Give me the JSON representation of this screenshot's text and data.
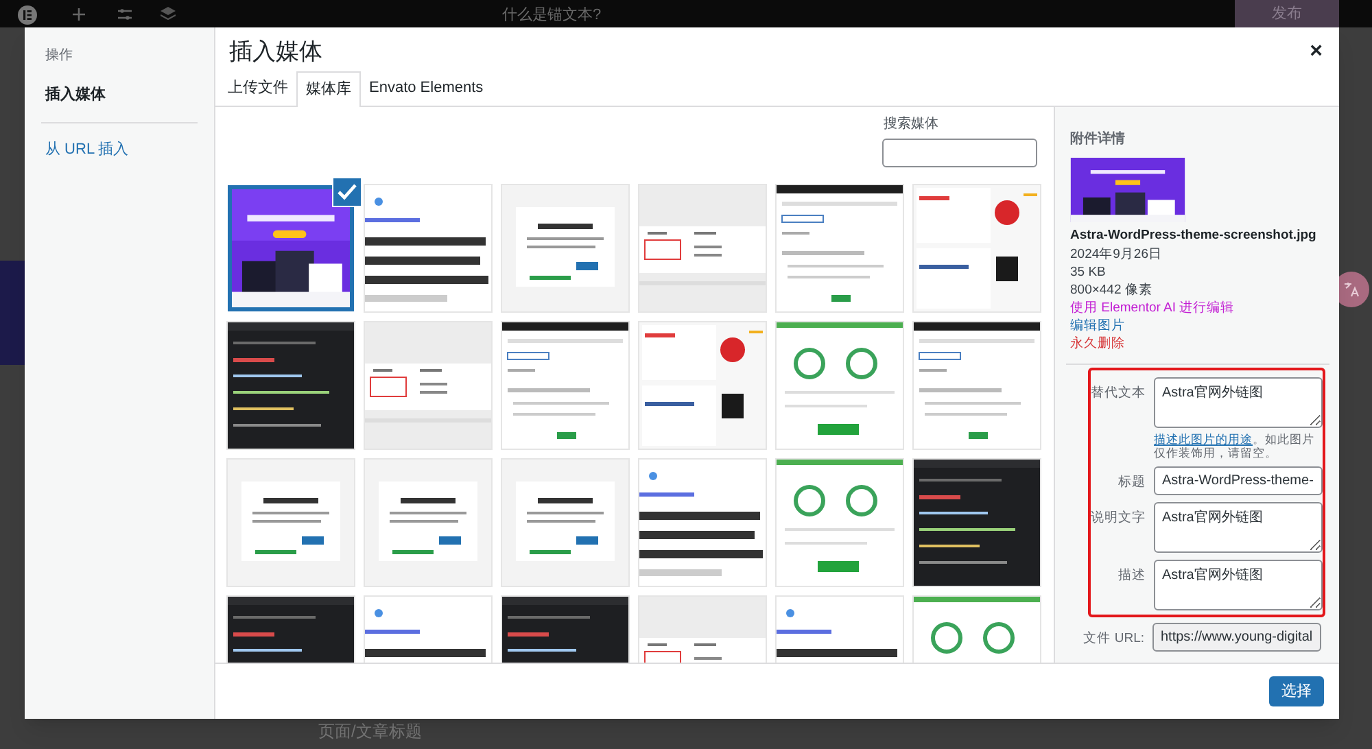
{
  "editor_bar": {
    "page_title": "什么是锚文本?",
    "publish": "发布"
  },
  "editor_page": {
    "heading": "页面/文章标题"
  },
  "modal": {
    "sidebar": {
      "heading": "操作",
      "items": [
        {
          "label": "插入媒体",
          "selected": true
        },
        {
          "label": "从 URL 插入",
          "selected": false
        }
      ]
    },
    "title": "插入媒体",
    "close": "×",
    "tabs": [
      {
        "label": "上传文件",
        "selected": false
      },
      {
        "label": "媒体库",
        "selected": true
      },
      {
        "label": "Envato Elements",
        "selected": false
      }
    ],
    "search": {
      "label": "搜索媒体"
    },
    "thumbnails": [
      {
        "kind": "picture",
        "selected": true
      },
      {
        "kind": "picture",
        "selected": false
      },
      {
        "kind": "picture",
        "selected": false
      },
      {
        "kind": "picture",
        "selected": false
      },
      {
        "kind": "picture",
        "selected": false
      },
      {
        "kind": "picture",
        "selected": false
      },
      {
        "kind": "picture",
        "selected": false
      },
      {
        "kind": "picture",
        "selected": false
      },
      {
        "kind": "picture",
        "selected": false
      },
      {
        "kind": "picture",
        "selected": false
      },
      {
        "kind": "picture",
        "selected": false
      },
      {
        "kind": "picture",
        "selected": false
      },
      {
        "kind": "picture",
        "selected": false
      },
      {
        "kind": "picture",
        "selected": false
      },
      {
        "kind": "picture",
        "selected": false
      },
      {
        "kind": "picture",
        "selected": false
      },
      {
        "kind": "picture",
        "selected": false
      },
      {
        "kind": "picture",
        "selected": false
      },
      {
        "kind": "picture",
        "selected": false
      },
      {
        "kind": "picture",
        "selected": false
      },
      {
        "kind": "picture",
        "selected": false
      },
      {
        "kind": "picture",
        "selected": false
      },
      {
        "kind": "picture",
        "selected": false
      },
      {
        "kind": "picture",
        "selected": false
      }
    ],
    "details": {
      "heading": "附件详情",
      "filename": "Astra-WordPress-theme-screenshot.jpg",
      "date": "2024年9月26日",
      "size": "35 KB",
      "dimensions": "800×442 像素",
      "links": [
        {
          "kind": "ai",
          "label": "使用 Elementor AI 进行编辑"
        },
        {
          "kind": "edit",
          "label": "编辑图片"
        },
        {
          "kind": "delete",
          "label": "永久删除"
        }
      ],
      "fields": [
        {
          "label": "替代文本",
          "kind": "textarea",
          "value": "Astra官网外链图",
          "help": {
            "link": "描述此图片的用途",
            "text": "。如此图片仅作装饰用，请留空。"
          }
        },
        {
          "label": "标题",
          "kind": "input",
          "value": "Astra-WordPress-theme-"
        },
        {
          "label": "说明文字",
          "kind": "textarea",
          "value": "Astra官网外链图"
        },
        {
          "label": "描述",
          "kind": "textarea",
          "value": "Astra官网外链图"
        },
        {
          "label": "文件 URL:",
          "kind": "url",
          "value": "https://www.young-digital"
        }
      ]
    },
    "select_button": "选择"
  }
}
